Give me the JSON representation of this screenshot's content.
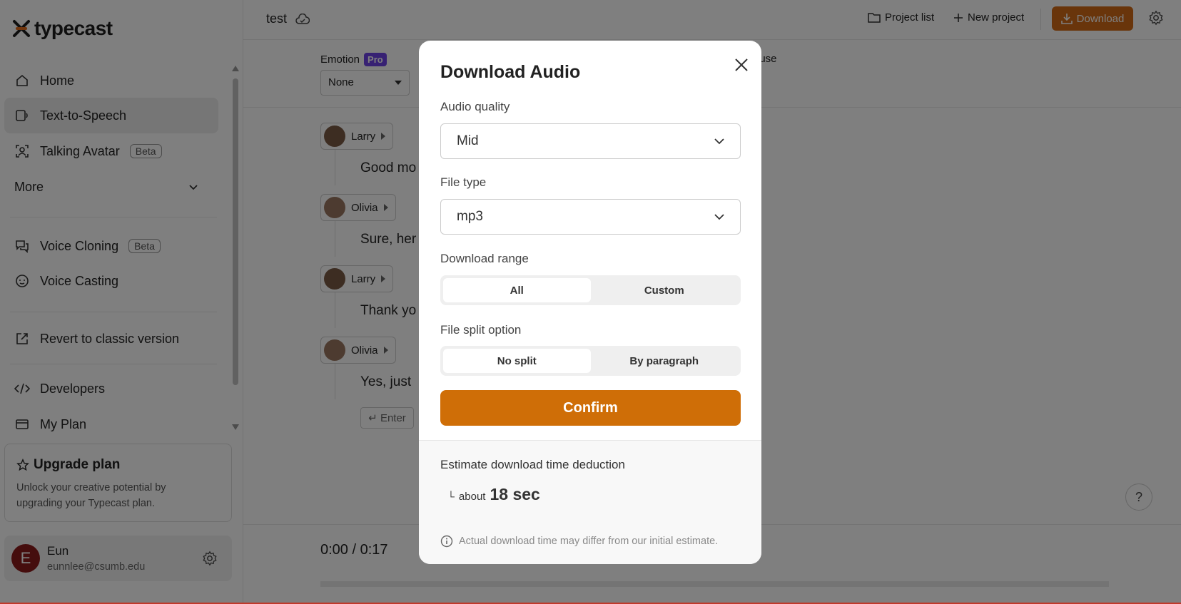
{
  "brand": {
    "name": "typecast"
  },
  "sidebar": {
    "items": [
      {
        "label": "Home",
        "icon": "home-icon"
      },
      {
        "label": "Text-to-Speech",
        "icon": "tts-icon",
        "active": true
      },
      {
        "label": "Talking Avatar",
        "icon": "avatar-frame-icon",
        "badge": "Beta"
      },
      {
        "label": "More",
        "icon": "chevron-down-icon"
      },
      {
        "label": "Voice Cloning",
        "icon": "chat-bubbles-icon",
        "badge": "Beta"
      },
      {
        "label": "Voice Casting",
        "icon": "face-icon"
      },
      {
        "label": "Revert to classic version",
        "icon": "external-link-icon"
      },
      {
        "label": "Developers",
        "icon": "code-icon"
      },
      {
        "label": "My Plan",
        "icon": "card-icon"
      }
    ],
    "upgrade": {
      "title": "Upgrade plan",
      "desc": "Unlock your creative potential by upgrading your Typecast plan."
    },
    "user": {
      "initial": "E",
      "name": "Eun",
      "email": "eunnlee@csumb.edu"
    }
  },
  "topbar": {
    "project_title": "test",
    "project_list": "Project list",
    "new_project": "New project",
    "download": "Download"
  },
  "toolbar": {
    "emotion_label": "Emotion",
    "pro_badge": "Pro",
    "emotion_value": "None",
    "pause_label": "ause"
  },
  "script": {
    "lines": [
      {
        "speaker": "Larry",
        "text": "Good mo"
      },
      {
        "speaker": "Olivia",
        "text": "Sure, her"
      },
      {
        "speaker": "Larry",
        "text": "Thank yo"
      },
      {
        "speaker": "Olivia",
        "text": "Yes, just"
      }
    ],
    "enter_label": "↵ Enter"
  },
  "player": {
    "time": "0:00 / 0:17"
  },
  "help": "?",
  "modal": {
    "title": "Download Audio",
    "quality_label": "Audio quality",
    "quality_value": "Mid",
    "filetype_label": "File type",
    "filetype_value": "mp3",
    "range_label": "Download range",
    "range_options": [
      "All",
      "Custom"
    ],
    "range_selected": "All",
    "split_label": "File split option",
    "split_options": [
      "No split",
      "By paragraph"
    ],
    "split_selected": "No split",
    "confirm": "Confirm",
    "estimate_title": "Estimate download time deduction",
    "estimate_corner": "└",
    "estimate_about": "about",
    "estimate_value": "18 sec",
    "estimate_note": "Actual download time may differ from our initial estimate."
  },
  "colors": {
    "accent": "#cf6e07",
    "pro": "#6e43e6",
    "avatar": "#8b1a1a"
  }
}
